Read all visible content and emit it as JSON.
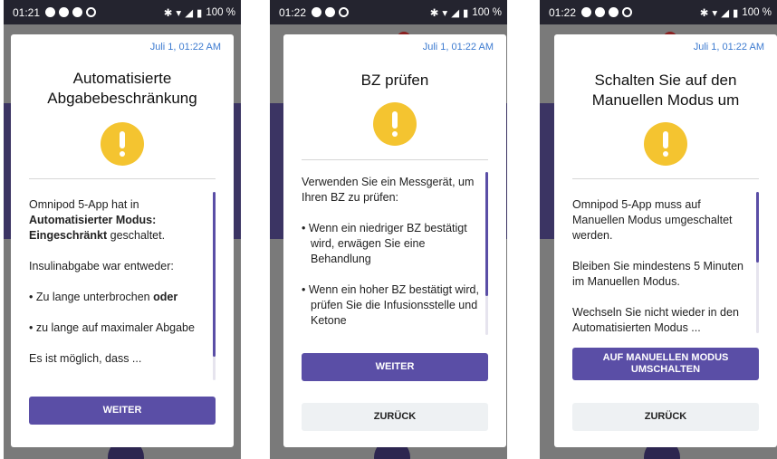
{
  "screens": [
    {
      "status": {
        "time": "01:21",
        "battery": "100 %"
      },
      "date": "Juli 1, 01:22 AM",
      "title": "Automatisierte Abgabebeschränkung",
      "body": {
        "p1_a": "Omnipod 5-App hat in ",
        "p1_b": "Automatisierter Modus: Eingeschränkt",
        "p1_c": " geschaltet.",
        "p2": "Insulinabgabe war entweder:",
        "b1_a": "• Zu lange unterbrochen ",
        "b1_b": "oder",
        "b2": "• zu lange auf maximaler Abgabe",
        "p3": "Es ist möglich, dass ..."
      },
      "primary_button": "WEITER"
    },
    {
      "status": {
        "time": "01:22",
        "battery": "100 %"
      },
      "date": "Juli 1, 01:22 AM",
      "title": "BZ prüfen",
      "body": {
        "p1": "Verwenden Sie ein Messgerät, um Ihren BZ zu prüfen:",
        "b1": "• Wenn ein niedriger BZ bestätigt wird, erwägen Sie eine Behandlung",
        "b2": "• Wenn ein hoher BZ bestätigt wird, prüfen Sie die Infusionsstelle und Ketone"
      },
      "primary_button": "WEITER",
      "secondary_button": "ZURÜCK"
    },
    {
      "status": {
        "time": "01:22",
        "battery": "100 %"
      },
      "date": "Juli 1, 01:22 AM",
      "title": "Schalten Sie auf den Manuellen Modus um",
      "body": {
        "p1": "Omnipod 5-App muss auf Manuellen Modus umgeschaltet werden.",
        "p2": "Bleiben Sie mindestens 5 Minuten im Manuellen Modus.",
        "p3": "Wechseln Sie nicht wieder in den Automatisierten Modus ..."
      },
      "primary_button": "AUF MANUELLEN MODUS UMSCHALTEN",
      "secondary_button": "ZURÜCK"
    }
  ],
  "colors": {
    "accent": "#5a4ea6",
    "warning": "#f4c430",
    "date": "#3d7bd0",
    "status_bar": "#24242f"
  },
  "icons": [
    "status-icons",
    "bluetooth-icon",
    "wifi-icon",
    "signal-icon",
    "battery-icon",
    "warning-icon"
  ]
}
